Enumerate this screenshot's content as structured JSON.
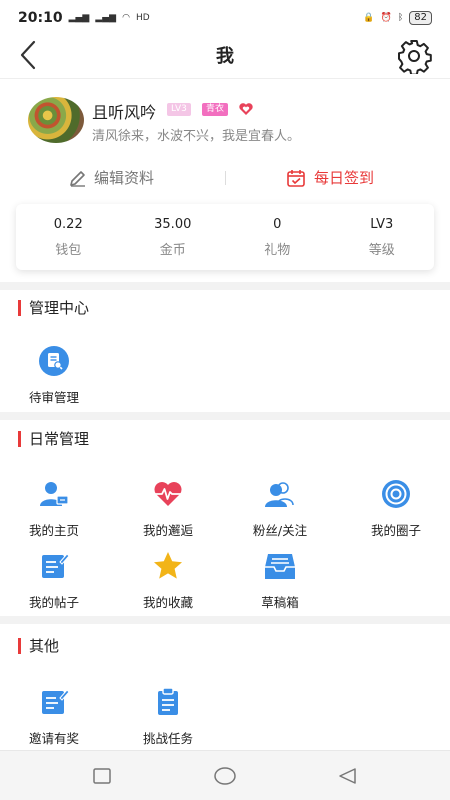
{
  "status_bar": {
    "time": "20:10",
    "network": "HD",
    "battery": "82"
  },
  "nav": {
    "title": "我"
  },
  "profile": {
    "username": "且听风吟",
    "level_badge": "LV3",
    "tag_badge": "青衣",
    "signature": "清风徐来，水波不兴，我是宜春人。"
  },
  "actions": {
    "edit": "编辑资料",
    "checkin": "每日签到"
  },
  "stats": [
    {
      "value": "0.22",
      "label": "钱包"
    },
    {
      "value": "35.00",
      "label": "金币"
    },
    {
      "value": "0",
      "label": "礼物"
    },
    {
      "value": "LV3",
      "label": "等级"
    }
  ],
  "sections": {
    "manage": {
      "title": "管理中心",
      "items": [
        {
          "label": "待审管理",
          "icon": "review-icon"
        }
      ]
    },
    "daily": {
      "title": "日常管理",
      "items": [
        {
          "label": "我的主页",
          "icon": "profile-card-icon"
        },
        {
          "label": "我的邂逅",
          "icon": "heartbeat-icon"
        },
        {
          "label": "粉丝/关注",
          "icon": "followers-icon"
        },
        {
          "label": "我的圈子",
          "icon": "circle-icon"
        },
        {
          "label": "我的帖子",
          "icon": "post-icon"
        },
        {
          "label": "我的收藏",
          "icon": "star-icon"
        },
        {
          "label": "草稿箱",
          "icon": "draft-box-icon"
        }
      ]
    },
    "other": {
      "title": "其他",
      "items": [
        {
          "label": "邀请有奖",
          "icon": "invite-icon"
        },
        {
          "label": "挑战任务",
          "icon": "task-clipboard-icon"
        }
      ]
    }
  },
  "colors": {
    "accent_red": "#e83a3a",
    "icon_blue": "#3a8ee6",
    "badge_pink": "#f26fbf"
  }
}
